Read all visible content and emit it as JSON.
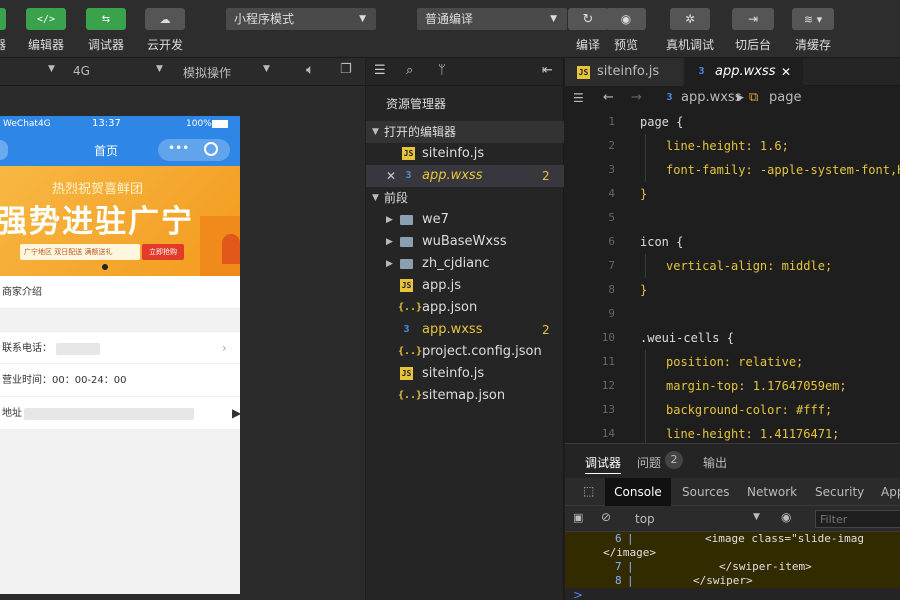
{
  "toolbar": {
    "partial_label": "器",
    "editor_label": "编辑器",
    "debugger_label": "调试器",
    "cloud_label": "云开发",
    "mode_select": "小程序模式",
    "compile_select": "普通编译",
    "compile_label": "编译",
    "preview_label": "预览",
    "device_debug_label": "真机调试",
    "background_label": "切后台",
    "clear_cache_label": "清缓存"
  },
  "simulator": {
    "network": "4G",
    "operation": "模拟操作",
    "status_carrier": "WeChat4G",
    "status_time": "13:37",
    "status_battery": "100%",
    "page_title": "首页",
    "banner_top": "热烈祝贺喜鲜团",
    "banner_main": "强势进驻广宁",
    "banner_sub": "广宁地区  双日配送  满额送礼",
    "banner_btn": "立即抢购",
    "rows": {
      "intro": "商家介绍",
      "phone": "联系电话：",
      "hours": "营业时间：00：00-24：00",
      "address": "地址"
    }
  },
  "explorer": {
    "title": "资源管理器",
    "open_editors": "打开的编辑器",
    "open_files": [
      {
        "name": "siteinfo.js",
        "badge": ""
      },
      {
        "name": "app.wxss",
        "badge": "2"
      }
    ],
    "project": "前段",
    "folders": [
      "we7",
      "wuBaseWxss",
      "zh_cjdianc"
    ],
    "files": [
      {
        "name": "app.js",
        "type": "js",
        "badge": ""
      },
      {
        "name": "app.json",
        "type": "json",
        "badge": ""
      },
      {
        "name": "app.wxss",
        "type": "css",
        "badge": "2"
      },
      {
        "name": "project.config.json",
        "type": "json",
        "badge": ""
      },
      {
        "name": "siteinfo.js",
        "type": "js",
        "badge": ""
      },
      {
        "name": "sitemap.json",
        "type": "json",
        "badge": ""
      }
    ]
  },
  "editor": {
    "tabs": [
      "siteinfo.js",
      "app.wxss"
    ],
    "crumb_file": "app.wxss",
    "crumb_sym": "page",
    "lines": [
      {
        "n": "1",
        "t": "page {"
      },
      {
        "n": "2",
        "t": "line-height: 1.6;"
      },
      {
        "n": "3",
        "t": "font-family: -apple-system-font,Helv"
      },
      {
        "n": "4",
        "t": "}"
      },
      {
        "n": "5",
        "t": ""
      },
      {
        "n": "6",
        "t": "icon {"
      },
      {
        "n": "7",
        "t": "vertical-align: middle;"
      },
      {
        "n": "8",
        "t": "}"
      },
      {
        "n": "9",
        "t": ""
      },
      {
        "n": "10",
        "t": ".weui-cells {"
      },
      {
        "n": "11",
        "t": "position: relative;"
      },
      {
        "n": "12",
        "t": "margin-top: 1.17647059em;"
      },
      {
        "n": "13",
        "t": "background-color: #fff;"
      },
      {
        "n": "14",
        "t": "line-height: 1.41176471;"
      }
    ]
  },
  "devtools": {
    "tab_debugger": "调试器",
    "tab_issues": "问题",
    "issues_count": "2",
    "tab_output": "输出",
    "panels": [
      "Console",
      "Sources",
      "Network",
      "Security",
      "App"
    ],
    "context": "top",
    "filter_placeholder": "Filter",
    "console_lines": [
      {
        "n": "6",
        "t": "<image class=\"slide-imag"
      },
      {
        "n": "",
        "t": "</image>"
      },
      {
        "n": "7",
        "t": "</swiper-item>"
      },
      {
        "n": "8",
        "t": "</swiper>"
      }
    ],
    "prompt": ">"
  },
  "colors": {
    "accent_green": "#3aa24c",
    "accent_blue": "#2e86e6",
    "badge": "#e6c43b"
  }
}
